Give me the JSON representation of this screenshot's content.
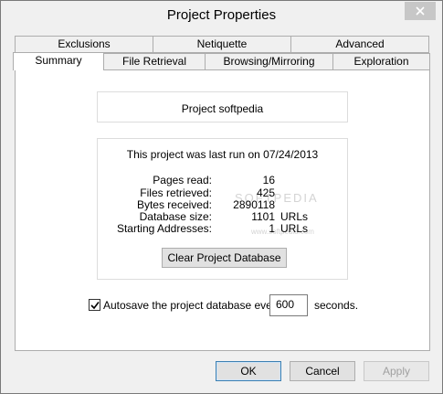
{
  "window": {
    "title": "Project Properties",
    "close_label": "✕"
  },
  "tabs": {
    "row1": [
      "Exclusions",
      "Netiquette",
      "Advanced"
    ],
    "row2": [
      "Summary",
      "File Retrieval",
      "Browsing/Mirroring",
      "Exploration"
    ],
    "active": "Summary"
  },
  "summary": {
    "project_name": "Project softpedia",
    "last_run_text": "This project was last run on 07/24/2013",
    "stats": [
      {
        "label": "Pages read:",
        "value": "16",
        "unit": ""
      },
      {
        "label": "Files retrieved:",
        "value": "425",
        "unit": ""
      },
      {
        "label": "Bytes received:",
        "value": "2890118",
        "unit": ""
      },
      {
        "label": "Database size:",
        "value": "1101",
        "unit": "URLs"
      },
      {
        "label": "Starting Addresses:",
        "value": "1",
        "unit": "URLs"
      }
    ],
    "clear_button": "Clear Project Database",
    "autosave": {
      "checked": true,
      "label": "Autosave the project database every",
      "value": "600",
      "suffix": "seconds."
    },
    "watermark": "SOFTPEDIA",
    "watermark_url": "www.softpedia.com"
  },
  "footer": {
    "ok": "OK",
    "cancel": "Cancel",
    "apply": "Apply"
  }
}
